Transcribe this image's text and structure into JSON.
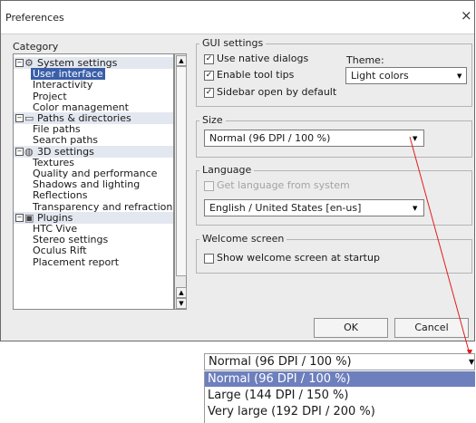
{
  "window": {
    "title": "Preferences",
    "close_glyph": "×"
  },
  "sidebar": {
    "header": "Category",
    "items": [
      {
        "label": "System settings",
        "icon": "gear-icon",
        "glyph": "⚙",
        "section": true
      },
      {
        "label": "User interface",
        "selected": true
      },
      {
        "label": "Interactivity"
      },
      {
        "label": "Project"
      },
      {
        "label": "Color management"
      },
      {
        "label": "Paths & directories",
        "icon": "folder-icon",
        "glyph": "▭",
        "section": true
      },
      {
        "label": "File paths"
      },
      {
        "label": "Search paths"
      },
      {
        "label": "3D settings",
        "icon": "cube-icon",
        "glyph": "◍",
        "section": true
      },
      {
        "label": "Textures"
      },
      {
        "label": "Quality and performance"
      },
      {
        "label": "Shadows and lighting"
      },
      {
        "label": "Reflections"
      },
      {
        "label": "Transparency and refraction"
      },
      {
        "label": "Plugins",
        "icon": "plugin-icon",
        "glyph": "▣",
        "section": true
      },
      {
        "label": "HTC Vive"
      },
      {
        "label": "Stereo settings"
      },
      {
        "label": "Oculus Rift"
      },
      {
        "label": "Placement report"
      }
    ]
  },
  "gui": {
    "label": "GUI settings",
    "native_dialogs": {
      "label": "Use native dialogs",
      "checked": true
    },
    "tool_tips": {
      "label": "Enable tool tips",
      "checked": true
    },
    "sidebar_open": {
      "label": "Sidebar open by default",
      "checked": true
    },
    "theme_label": "Theme:",
    "theme_value": "Light colors"
  },
  "size": {
    "label": "Size",
    "value": "Normal (96 DPI / 100 %)"
  },
  "language": {
    "label": "Language",
    "from_system": {
      "label": "Get language from system",
      "checked": false,
      "disabled": true
    },
    "value": "English / United States  [en-us]"
  },
  "welcome": {
    "label": "Welcome screen",
    "show_at_startup": {
      "label": "Show welcome screen at startup",
      "checked": false
    }
  },
  "buttons": {
    "ok": "OK",
    "cancel": "Cancel"
  },
  "size_popup": {
    "current": "Normal (96 DPI / 100 %)",
    "options": [
      {
        "label": "Normal (96 DPI / 100 %)",
        "selected": true
      },
      {
        "label": "Large (144 DPI / 150 %)"
      },
      {
        "label": "Very large (192 DPI / 200 %)"
      }
    ]
  },
  "colors": {
    "selection": "#3a5ea8",
    "popup_selection": "#6d7fbd",
    "callout_line": "#e31b1b"
  }
}
